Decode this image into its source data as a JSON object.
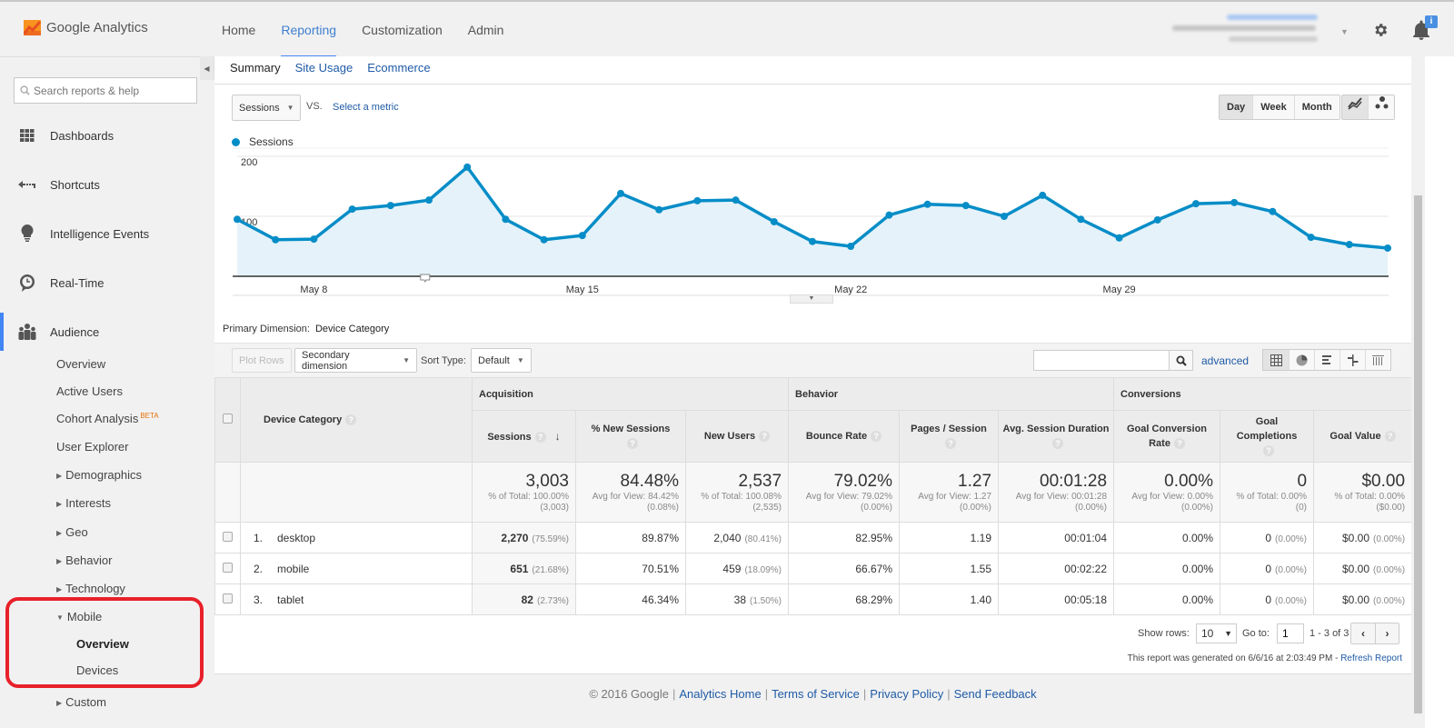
{
  "app": {
    "name": "Google Analytics"
  },
  "nav": {
    "items": [
      "Home",
      "Reporting",
      "Customization",
      "Admin"
    ],
    "active": "Reporting"
  },
  "header": {
    "notification_badge": "i"
  },
  "sidebar": {
    "search_placeholder": "Search reports & help",
    "main_items": [
      "Dashboards",
      "Shortcuts",
      "Intelligence Events",
      "Real-Time",
      "Audience"
    ],
    "audience_items": {
      "overview": "Overview",
      "active_users": "Active Users",
      "cohort": "Cohort Analysis",
      "cohort_badge": "BETA",
      "user_explorer": "User Explorer",
      "demographics": "Demographics",
      "interests": "Interests",
      "geo": "Geo",
      "behavior": "Behavior",
      "technology": "Technology",
      "mobile": "Mobile",
      "mobile_overview": "Overview",
      "mobile_devices": "Devices",
      "custom": "Custom"
    }
  },
  "subtabs": [
    "Summary",
    "Site Usage",
    "Ecommerce"
  ],
  "chart_controls": {
    "metric": "Sessions",
    "vs": "VS.",
    "select_metric": "Select a metric",
    "granularity": [
      "Day",
      "Week",
      "Month"
    ],
    "granularity_active": "Day"
  },
  "chart_data": {
    "type": "area",
    "title": "",
    "legend": [
      "Sessions"
    ],
    "series": [
      {
        "name": "Sessions",
        "color": "#058dc7",
        "values": [
          95,
          61,
          62,
          112,
          118,
          127,
          182,
          95,
          61,
          68,
          138,
          111,
          126,
          127,
          91,
          58,
          50,
          102,
          120,
          118,
          100,
          135,
          95,
          64,
          94,
          121,
          123,
          108,
          65,
          53,
          47
        ]
      }
    ],
    "x_start": "May 6",
    "x_tick_labels": [
      {
        "index": 2,
        "label": "May 8"
      },
      {
        "index": 9,
        "label": "May 15"
      },
      {
        "index": 16,
        "label": "May 22"
      },
      {
        "index": 23,
        "label": "May 29"
      }
    ],
    "y_ticks": [
      "100",
      "200"
    ],
    "ylim": [
      0,
      200
    ],
    "grid": true
  },
  "table": {
    "primary_dimension_label": "Primary Dimension:",
    "primary_dimension": "Device Category",
    "plot_rows": "Plot Rows",
    "secondary_dimension": "Secondary dimension",
    "sort_type_label": "Sort Type:",
    "sort_type": "Default",
    "advanced": "advanced",
    "groups": [
      "Acquisition",
      "Behavior",
      "Conversions"
    ],
    "dimension_header": "Device Category",
    "columns": [
      "Sessions",
      "% New Sessions",
      "New Users",
      "Bounce Rate",
      "Pages / Session",
      "Avg. Session Duration",
      "Goal Conversion Rate",
      "Goal Completions",
      "Goal Value"
    ],
    "totals": [
      {
        "value": "3,003",
        "line1": "% of Total: 100.00%",
        "line2": "(3,003)"
      },
      {
        "value": "84.48%",
        "line1": "Avg for View: 84.42%",
        "line2": "(0.08%)"
      },
      {
        "value": "2,537",
        "line1": "% of Total: 100.08%",
        "line2": "(2,535)"
      },
      {
        "value": "79.02%",
        "line1": "Avg for View: 79.02%",
        "line2": "(0.00%)"
      },
      {
        "value": "1.27",
        "line1": "Avg for View: 1.27",
        "line2": "(0.00%)"
      },
      {
        "value": "00:01:28",
        "line1": "Avg for View: 00:01:28",
        "line2": "(0.00%)"
      },
      {
        "value": "0.00%",
        "line1": "Avg for View: 0.00%",
        "line2": "(0.00%)"
      },
      {
        "value": "0",
        "line1": "% of Total: 0.00%",
        "line2": "(0)"
      },
      {
        "value": "$0.00",
        "line1": "% of Total: 0.00%",
        "line2": "($0.00)"
      }
    ],
    "rows": [
      {
        "idx": "1.",
        "name": "desktop",
        "sessions": "2,270",
        "sessions_pct": "(75.59%)",
        "new_sessions": "89.87%",
        "new_users": "2,040",
        "new_users_pct": "(80.41%)",
        "bounce": "82.95%",
        "pages": "1.19",
        "duration": "00:01:04",
        "conv_rate": "0.00%",
        "completions": "0",
        "completions_pct": "(0.00%)",
        "goal_value": "$0.00",
        "goal_value_pct": "(0.00%)"
      },
      {
        "idx": "2.",
        "name": "mobile",
        "sessions": "651",
        "sessions_pct": "(21.68%)",
        "new_sessions": "70.51%",
        "new_users": "459",
        "new_users_pct": "(18.09%)",
        "bounce": "66.67%",
        "pages": "1.55",
        "duration": "00:02:22",
        "conv_rate": "0.00%",
        "completions": "0",
        "completions_pct": "(0.00%)",
        "goal_value": "$0.00",
        "goal_value_pct": "(0.00%)"
      },
      {
        "idx": "3.",
        "name": "tablet",
        "sessions": "82",
        "sessions_pct": "(2.73%)",
        "new_sessions": "46.34%",
        "new_users": "38",
        "new_users_pct": "(1.50%)",
        "bounce": "68.29%",
        "pages": "1.40",
        "duration": "00:05:18",
        "conv_rate": "0.00%",
        "completions": "0",
        "completions_pct": "(0.00%)",
        "goal_value": "$0.00",
        "goal_value_pct": "(0.00%)"
      }
    ]
  },
  "pager": {
    "show_rows_label": "Show rows:",
    "show_rows": "10",
    "goto_label": "Go to:",
    "goto_value": "1",
    "range": "1 - 3 of 3"
  },
  "report_generated": "This report was generated on 6/6/16 at 2:03:49 PM - ",
  "refresh_report": "Refresh Report",
  "footer": {
    "copyright": "© 2016 Google",
    "links": [
      "Analytics Home",
      "Terms of Service",
      "Privacy Policy",
      "Send Feedback"
    ]
  }
}
